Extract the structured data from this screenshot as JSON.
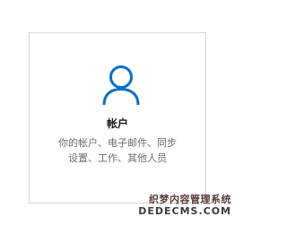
{
  "colors": {
    "accent": "#0a6fc2",
    "border": "#d6d6d6",
    "title": "#1a1a1a",
    "description": "#6b6b6b"
  },
  "tile": {
    "icon": "user-account-icon",
    "title": "帐户",
    "description_lines": [
      "你的帐户、电子邮件、同步",
      "设置、工作、其他人员"
    ]
  },
  "watermark": {
    "line1": "织梦内容管理系统",
    "line2": "DEDECMS.COM"
  }
}
